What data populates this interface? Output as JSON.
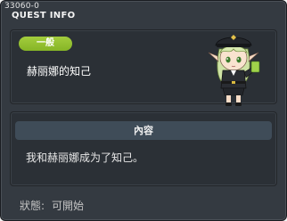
{
  "window": {
    "quest_id": "33060-0",
    "title": "QUEST INFO"
  },
  "quest": {
    "category_badge": "一般",
    "name": "赫丽娜的知己"
  },
  "npc": {
    "icon": "npc-helena-portrait-icon"
  },
  "content": {
    "header": "內容",
    "text": "我和赫丽娜成为了知己。"
  },
  "status": {
    "label": "狀態:",
    "value": "可開始"
  },
  "colors": {
    "window_bg": "#343a41",
    "panel_bg": "#2b3036",
    "badge_green": "#94c233",
    "header_bg": "#3f4c58"
  }
}
